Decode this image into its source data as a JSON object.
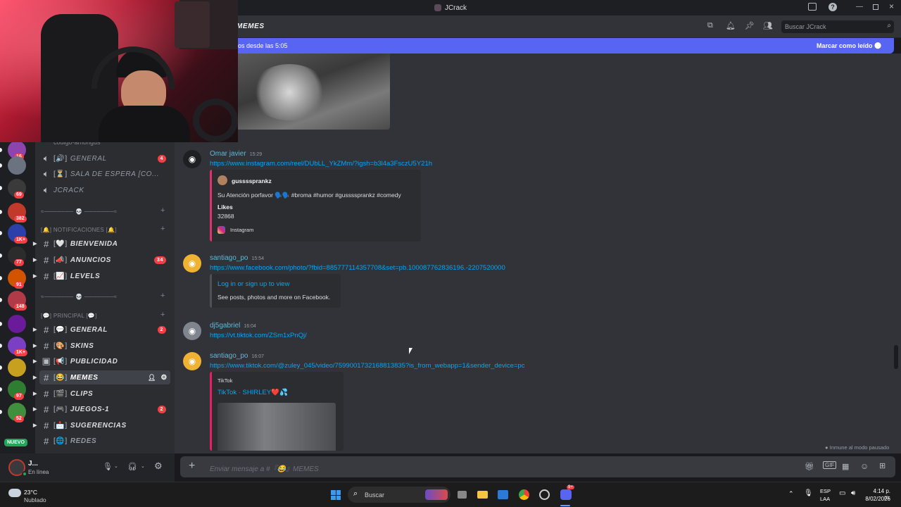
{
  "window": {
    "title": "JCrack"
  },
  "header": {
    "channel_name": "MEMES",
    "search_placeholder": "Buscar JCrack"
  },
  "new_messages_bar": {
    "text": "os desde las 5:05",
    "mark_read": "Marcar como leído"
  },
  "servers": [
    {
      "badge": "16"
    },
    {
      "badge": ""
    },
    {
      "badge": "69"
    },
    {
      "badge": "382"
    },
    {
      "badge": "1K+"
    },
    {
      "badge": "77"
    },
    {
      "badge": "91"
    },
    {
      "badge": "148"
    },
    {
      "badge": ""
    },
    {
      "badge": "1K+"
    },
    {
      "badge": ""
    },
    {
      "badge": "97"
    },
    {
      "badge": "52"
    }
  ],
  "rail_new_label": "NUEVO",
  "channels": {
    "partial_top": "codigo-amongus",
    "voice": [
      {
        "bracket": "[🔊]",
        "name": "GENERAL",
        "count": "4"
      },
      {
        "bracket": "[⏳]",
        "name": "SALA DE ESPERA [CO..."
      },
      {
        "bracket": "",
        "name": "JCRACK"
      }
    ],
    "cat_divider1": "≈─────── 💀 ───────≈",
    "cat_notificaciones": "[🔔] NOTIFICACIONES [🔔]",
    "notif": [
      {
        "bracket": "[🤍]",
        "name": "BIENVENIDA",
        "count": ""
      },
      {
        "bracket": "[📣]",
        "name": "ANUNCIOS",
        "count": "34"
      },
      {
        "bracket": "[📈]",
        "name": "LEVELS",
        "count": ""
      }
    ],
    "cat_divider2": "≈─────── 💀 ───────≈",
    "cat_principal": "[💬] PRINCIPAL [💬]",
    "principal": [
      {
        "bracket": "[💬]",
        "name": "GENERAL",
        "count": "2"
      },
      {
        "bracket": "[🎨]",
        "name": "SKINS",
        "count": ""
      },
      {
        "bracket": "[📢]",
        "name": "PUBLICIDAD",
        "count": ""
      },
      {
        "bracket": "[😂]",
        "name": "MEMES",
        "count": ""
      },
      {
        "bracket": "[🎬]",
        "name": "CLIPS",
        "count": ""
      },
      {
        "bracket": "[🎮]",
        "name": "JUEGOS-1",
        "count": "2"
      },
      {
        "bracket": "[📩]",
        "name": "SUGERENCIAS",
        "count": ""
      },
      {
        "bracket": "[🌐]",
        "name": "REDES",
        "count": ""
      }
    ]
  },
  "user": {
    "name": "J...",
    "status": "En línea"
  },
  "messages": [
    {
      "author": "Omar javier",
      "time": "15:29",
      "link": "https://www.instagram.com/reel/DUbLL_YkZMm/?igsh=b3l4a3FsczU5Y21h",
      "embed": {
        "author": "gussssprankz",
        "desc": "Su Atención porfavor 🗣️🗣️ #broma #humor #gussssprankz #comedy",
        "field_name": "Likes",
        "field_value": "32868",
        "footer": "Instagram"
      }
    },
    {
      "author": "santiago_po",
      "time": "15:54",
      "link": "https://www.facebook.com/photo/?fbid=885777114357708&set=pb.100087762836196.-2207520000",
      "embed": {
        "title": "Log in or sign up to view",
        "desc": "See posts, photos and more on Facebook."
      }
    },
    {
      "author": "dj5gabriel",
      "time": "16:04",
      "link": "https://vt.tiktok.com/ZSm1xPnQj/"
    },
    {
      "author": "santiago_po",
      "time": "16:07",
      "link": "https://www.tiktok.com/@zuley_045/video/7599001732168813835?is_from_webapp=1&sender_device=pc",
      "embed": {
        "provider": "TikTok",
        "title": "TikTok · SHIRLEY❤️💦"
      }
    }
  ],
  "status_note": "Inmune al modo pausado",
  "composer": {
    "placeholder": "Enviar mensaje a #『😂』MEMES"
  },
  "taskbar": {
    "temp": "23°C",
    "weather": "Nublado",
    "search": "Buscar",
    "lang1": "ESP",
    "lang2": "LAA",
    "time": "4:14 p. m.",
    "date": "8/02/2026",
    "discord_badge": "9+"
  },
  "colors": {
    "accent": "#5865f2",
    "link": "#00a8fc",
    "mention_red": "#f23f43",
    "instagram_embed": "#e1306c",
    "facebook_embed": "#4e5058",
    "tiktok_embed": "#e91e63"
  }
}
